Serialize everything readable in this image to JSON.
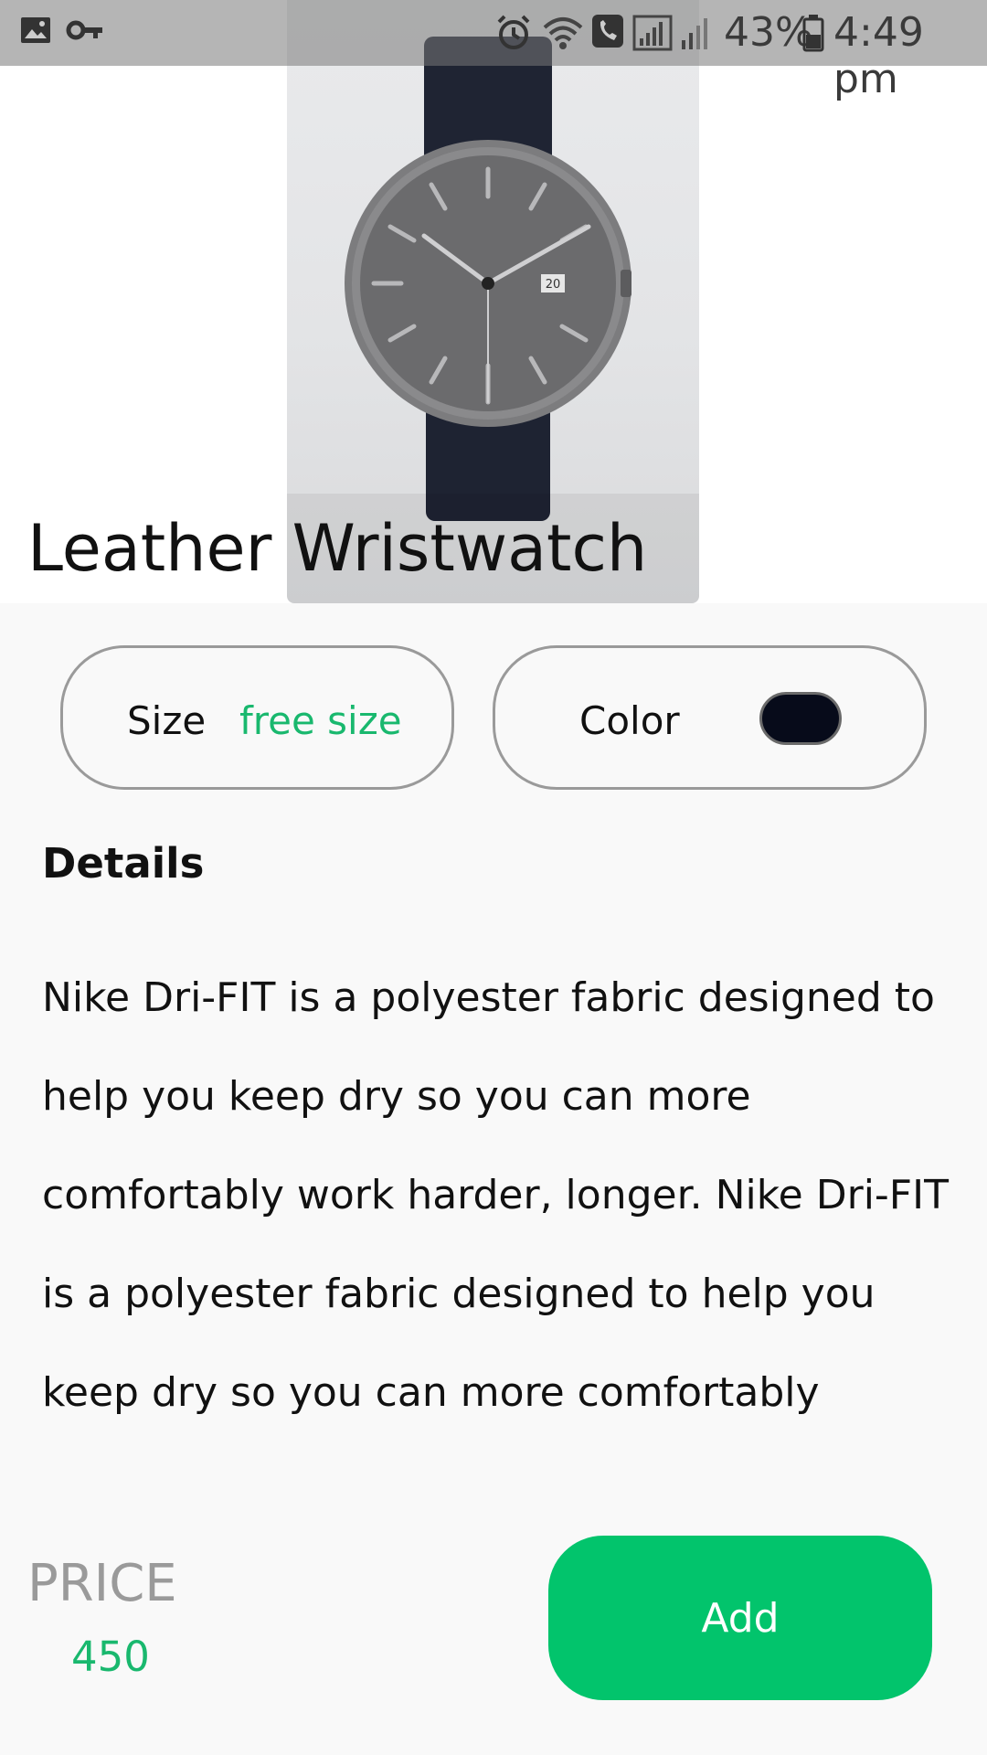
{
  "status_bar": {
    "battery_percent": "43%",
    "time": "4:49 pm",
    "icons": [
      "image-icon",
      "key-icon",
      "alarm-icon",
      "wifi-call-icon",
      "phone-icon",
      "signal-icon",
      "signal-weak-icon",
      "battery-icon"
    ]
  },
  "product": {
    "title": "Leather Wristwatch",
    "image_icon": "wristwatch-image",
    "watch_date": "20",
    "size": {
      "label": "Size",
      "value": "free size"
    },
    "color": {
      "label": "Color",
      "swatch": "#070b1a"
    }
  },
  "details": {
    "heading": "Details",
    "text": "Nike Dri-FIT is a polyester fabric designed to help you keep dry so you can more comfortably work harder, longer. Nike Dri-FIT is a polyester fabric designed to help you keep dry so you can more comfortably"
  },
  "price": {
    "label": "PRICE",
    "value": "450"
  },
  "actions": {
    "add_label": "Add"
  },
  "colors": {
    "accent": "#02c46c",
    "accent_text": "#19b86e",
    "muted": "#9a9a9a"
  }
}
